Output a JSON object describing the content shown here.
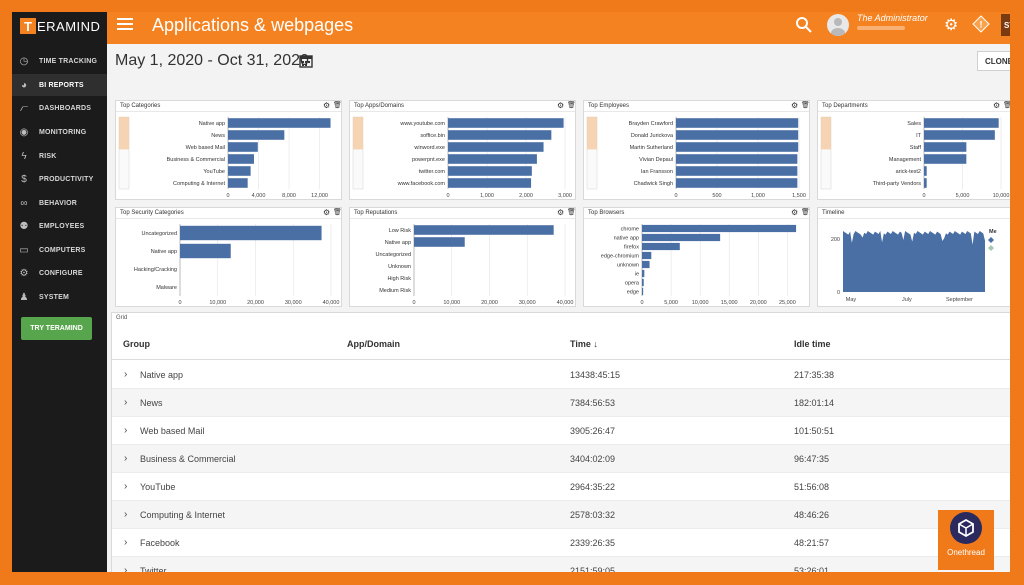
{
  "app": {
    "logo_letter": "T",
    "logo_rest": "ERAMIND",
    "title": "Applications & webpages",
    "user": "The Administrator",
    "start_label": "STA"
  },
  "sidebar": {
    "items": [
      {
        "label": "TIME TRACKING",
        "icon": "clock-icon"
      },
      {
        "label": "BI REPORTS",
        "icon": "pie-chart-icon"
      },
      {
        "label": "DASHBOARDS",
        "icon": "line-chart-icon"
      },
      {
        "label": "MONITORING",
        "icon": "eye-icon"
      },
      {
        "label": "RISK",
        "icon": "lightning-icon"
      },
      {
        "label": "PRODUCTIVITY",
        "icon": "dollar-icon"
      },
      {
        "label": "BEHAVIOR",
        "icon": "binoculars-icon"
      },
      {
        "label": "EMPLOYEES",
        "icon": "users-icon"
      },
      {
        "label": "COMPUTERS",
        "icon": "monitor-icon"
      },
      {
        "label": "CONFIGURE",
        "icon": "gear-icon"
      },
      {
        "label": "SYSTEM",
        "icon": "user-gear-icon"
      }
    ],
    "try_label": "TRY TERAMIND",
    "active_color": "#2f2f2f"
  },
  "header": {
    "date_range": "May 1, 2020 - Oct 31, 2020",
    "clone_label": "CLONE"
  },
  "colors": {
    "accent": "#f58220",
    "bar": "#4a6fa5"
  },
  "cards": [
    {
      "title": "Top Categories",
      "categories": [
        "Native app",
        "News",
        "Web based Mail",
        "Business & Commercial",
        "YouTube",
        "Computing & Internet"
      ],
      "values": [
        13438,
        7384,
        3905,
        3404,
        2964,
        2578
      ],
      "ticks": [
        "0",
        "4,000",
        "8,000",
        "12,000"
      ],
      "tick_values": [
        0,
        4000,
        8000,
        12000
      ],
      "xmax": 13500
    },
    {
      "title": "Top Apps/Domains",
      "categories": [
        "www.youtube.com",
        "soffice.bin",
        "winword.exe",
        "powerpnt.exe",
        "twitter.com",
        "www.facebook.com"
      ],
      "values": [
        2964,
        2650,
        2450,
        2280,
        2150,
        2130
      ],
      "ticks": [
        "0",
        "1,000",
        "2,000",
        "3,000"
      ],
      "tick_values": [
        0,
        1000,
        2000,
        3000
      ],
      "xmax": 3000
    },
    {
      "title": "Top Employees",
      "categories": [
        "Brayden Crawford",
        "Donald Jurickova",
        "Martin Sutherland",
        "Vivian Depaul",
        "Ian Fransson",
        "Chadwick Singh"
      ],
      "values": [
        1490,
        1490,
        1490,
        1480,
        1480,
        1480
      ],
      "ticks": [
        "0",
        "500",
        "1,000",
        "1,500"
      ],
      "tick_values": [
        0,
        500,
        1000,
        1500
      ],
      "xmax": 1500
    },
    {
      "title": "Top Departments",
      "categories": [
        "Sales",
        "IT",
        "Staff",
        "Management",
        "arick-test2",
        "Third-party Vendors"
      ],
      "values": [
        9700,
        9200,
        5500,
        5500,
        350,
        350
      ],
      "ticks": [
        "0",
        "5,000",
        "10,000"
      ],
      "tick_values": [
        0,
        5000,
        10000
      ],
      "xmax": 10000
    },
    {
      "title": "Top Security Categories",
      "categories": [
        "Uncategorized",
        "Native app",
        "Hacking/Cracking",
        "Malware"
      ],
      "values": [
        37500,
        13438,
        0,
        0
      ],
      "ticks": [
        "0",
        "10,000",
        "20,000",
        "30,000",
        "40,000"
      ],
      "tick_values": [
        0,
        10000,
        20000,
        30000,
        40000
      ],
      "xmax": 40000
    },
    {
      "title": "Top Reputations",
      "categories": [
        "Low Risk",
        "Native app",
        "Uncategorized",
        "Unknown",
        "High Risk",
        "Medium Risk"
      ],
      "values": [
        37000,
        13438,
        0,
        0,
        0,
        0
      ],
      "ticks": [
        "0",
        "10,000",
        "20,000",
        "30,000",
        "40,000"
      ],
      "tick_values": [
        0,
        10000,
        20000,
        30000,
        40000
      ],
      "xmax": 40000
    },
    {
      "title": "Top Browsers",
      "categories": [
        "chrome",
        "native app",
        "firefox",
        "edge-chromium",
        "unknown",
        "ie",
        "opera",
        "edge"
      ],
      "values": [
        26500,
        13438,
        6500,
        1600,
        1300,
        400,
        300,
        200
      ],
      "ticks": [
        "0",
        "5,000",
        "10,000",
        "15,000",
        "20,000",
        "25,000"
      ],
      "tick_values": [
        0,
        5000,
        10000,
        15000,
        20000,
        25000
      ],
      "xmax": 27000
    },
    {
      "title": "Timeline",
      "x_ticks": [
        "May",
        "July",
        "September"
      ],
      "y_ticks": [
        "200",
        "0"
      ],
      "legend": "Me"
    }
  ],
  "grid": {
    "title": "Grid",
    "headers": {
      "group": "Group",
      "app": "App/Domain",
      "time": "Time",
      "idle": "Idle time"
    },
    "rows": [
      {
        "group": "Native app",
        "time": "13438:45:15",
        "idle": "217:35:38"
      },
      {
        "group": "News",
        "time": "7384:56:53",
        "idle": "182:01:14"
      },
      {
        "group": "Web based Mail",
        "time": "3905:26:47",
        "idle": "101:50:51"
      },
      {
        "group": "Business & Commercial",
        "time": "3404:02:09",
        "idle": "96:47:35"
      },
      {
        "group": "YouTube",
        "time": "2964:35:22",
        "idle": "51:56:08"
      },
      {
        "group": "Computing & Internet",
        "time": "2578:03:32",
        "idle": "48:46:26"
      },
      {
        "group": "Facebook",
        "time": "2339:26:35",
        "idle": "48:21:57"
      },
      {
        "group": "Twitter",
        "time": "2151:59:05",
        "idle": "53:26:01"
      }
    ]
  },
  "watermark": "Onethread"
}
